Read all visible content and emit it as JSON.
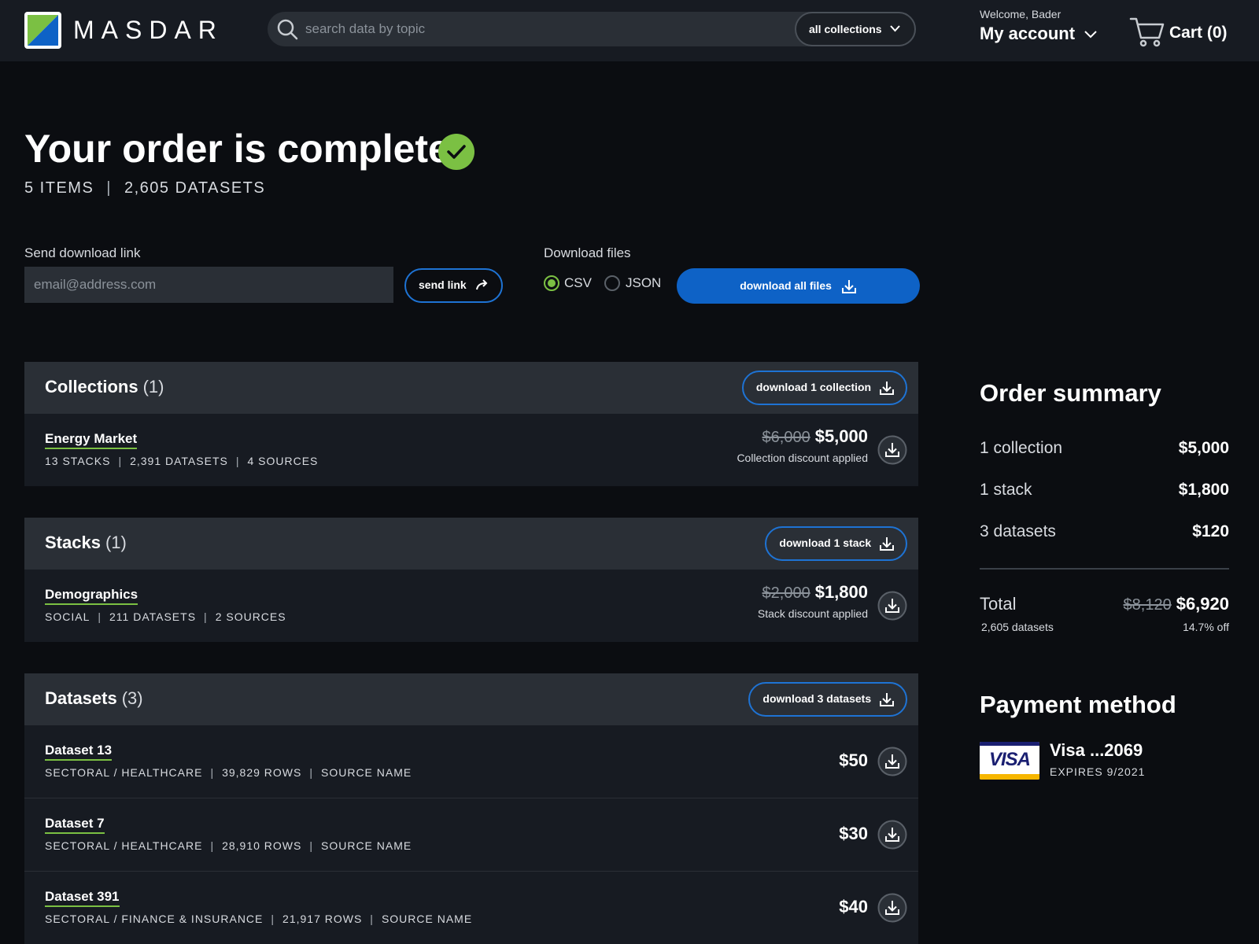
{
  "header": {
    "brand": "MASDAR",
    "search_placeholder": "search data by topic",
    "scope_label": "all collections",
    "welcome": "Welcome, Bader",
    "account_label": "My account",
    "cart_label": "Cart (0)"
  },
  "page": {
    "title": "Your order is complete",
    "items_count": "5 ITEMS",
    "datasets_count": "2,605 DATASETS"
  },
  "send_link": {
    "label": "Send download link",
    "email_placeholder": "email@address.com",
    "button_label": "send link"
  },
  "download": {
    "label": "Download files",
    "formats": [
      {
        "label": "CSV",
        "selected": true
      },
      {
        "label": "JSON",
        "selected": false
      }
    ],
    "button_label": "download all files"
  },
  "collections": {
    "title": "Collections",
    "count": "(1)",
    "button_label": "download 1 collection",
    "items": [
      {
        "name": "Energy Market",
        "meta": [
          "13 STACKS",
          "2,391 DATASETS",
          "4 SOURCES"
        ],
        "old_price": "$6,000",
        "price": "$5,000",
        "note": "Collection discount applied"
      }
    ]
  },
  "stacks": {
    "title": "Stacks",
    "count": "(1)",
    "button_label": "download 1 stack",
    "items": [
      {
        "name": "Demographics",
        "meta": [
          "SOCIAL",
          "211 DATASETS",
          "2 SOURCES"
        ],
        "old_price": "$2,000",
        "price": "$1,800",
        "note": "Stack discount applied"
      }
    ]
  },
  "datasets": {
    "title": "Datasets",
    "count": "(3)",
    "button_label": "download 3 datasets",
    "items": [
      {
        "name": "Dataset 13",
        "meta": [
          "SECTORAL / HEALTHCARE",
          "39,829  ROWS",
          "SOURCE NAME"
        ],
        "price": "$50"
      },
      {
        "name": "Dataset 7",
        "meta": [
          "SECTORAL / HEALTHCARE",
          "28,910  ROWS",
          "SOURCE NAME"
        ],
        "price": "$30"
      },
      {
        "name": "Dataset 391",
        "meta": [
          "SECTORAL / FINANCE & INSURANCE",
          "21,917  ROWS",
          "SOURCE NAME"
        ],
        "price": "$40"
      }
    ]
  },
  "summary": {
    "title": "Order summary",
    "lines": [
      {
        "label": "1 collection",
        "value": "$5,000"
      },
      {
        "label": "1 stack",
        "value": "$1,800"
      },
      {
        "label": "3 datasets",
        "value": "$120"
      }
    ],
    "total_label": "Total",
    "total_old": "$8,120",
    "total_value": "$6,920",
    "total_sub": "2,605 datasets",
    "total_off": "14.7% off"
  },
  "payment": {
    "title": "Payment method",
    "card_brand": "VISA",
    "card_name": "Visa ...2069",
    "expires": "EXPIRES 9/2021"
  },
  "colors": {
    "background": "#0b0d11",
    "header_bg": "#171b22",
    "panel_bg": "#2a2f36",
    "accent_blue": "#0e62c6",
    "accent_green": "#7bc043"
  },
  "icons": [
    "masdar-logo",
    "search-icon",
    "chevron-down-icon",
    "cart-icon",
    "check-circle-icon",
    "share-icon",
    "download-icon",
    "visa-card-icon"
  ]
}
